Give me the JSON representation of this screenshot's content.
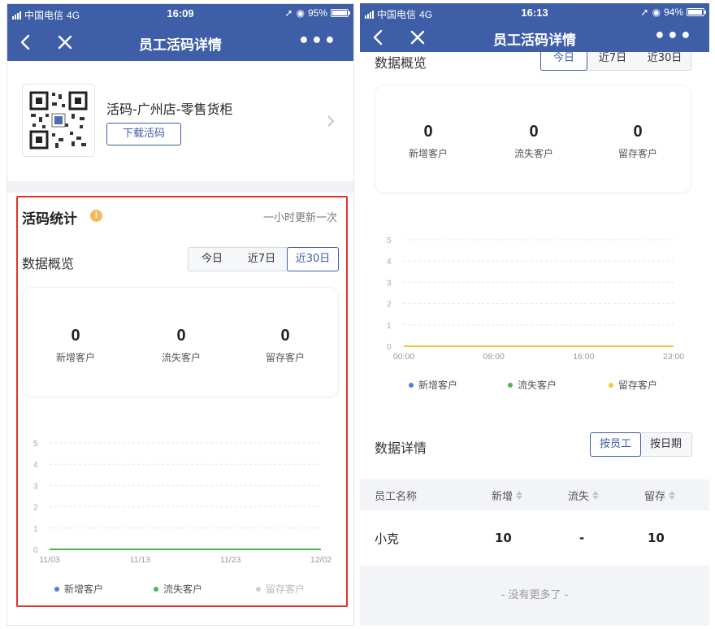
{
  "colors": {
    "nav": "#3e5ea8",
    "accent": "#3e5ea8",
    "highlight": "#e0342b",
    "series_new": "#4a7fe0",
    "series_lost": "#4fb35b",
    "series_keep": "#f0c945"
  },
  "left": {
    "status": {
      "carrier": "中国电信",
      "network": "4G",
      "time": "16:09",
      "battery": "95%"
    },
    "nav": {
      "title": "员工活码详情",
      "more": "•••"
    },
    "qr": {
      "name": "活码-广州店-零售货柜",
      "download_label": "下载活码"
    },
    "stats": {
      "title": "活码统计",
      "info_icon": "i",
      "update_note": "一小时更新一次",
      "overview_title": "数据概览",
      "ranges": [
        "今日",
        "近7日",
        "近30日"
      ],
      "active_range": "近30日",
      "items": [
        {
          "value": "0",
          "label": "新增客户"
        },
        {
          "value": "0",
          "label": "流失客户"
        },
        {
          "value": "0",
          "label": "留存客户"
        }
      ]
    },
    "legend": [
      "新增客户",
      "流失客户",
      "留存客户"
    ]
  },
  "right": {
    "status": {
      "carrier": "中国电信",
      "network": "4G",
      "time": "16:13",
      "battery": "94%"
    },
    "nav": {
      "title": "员工活码详情",
      "more": "•••"
    },
    "stats": {
      "overview_title": "数据概览",
      "ranges": [
        "今日",
        "近7日",
        "近30日"
      ],
      "items": [
        {
          "value": "0",
          "label": "新增客户"
        },
        {
          "value": "0",
          "label": "流失客户"
        },
        {
          "value": "0",
          "label": "留存客户"
        }
      ]
    },
    "legend": [
      "新增客户",
      "流失客户",
      "留存客户"
    ],
    "detail": {
      "title": "数据详情",
      "tabs": [
        "按员工",
        "按日期"
      ],
      "active_tab": "按员工",
      "columns": [
        "员工名称",
        "新增",
        "流失",
        "留存"
      ],
      "rows": [
        {
          "name": "小克",
          "new": "10",
          "lost": "-",
          "keep": "10"
        }
      ],
      "footer": "- 没有更多了 -"
    }
  },
  "chart_data": [
    {
      "type": "line",
      "x": [
        "11/03",
        "11/13",
        "11/23",
        "12/02"
      ],
      "ylim": [
        0,
        5
      ],
      "yticks": [
        0,
        1,
        2,
        3,
        4,
        5
      ],
      "grid": true,
      "legend_position": "bottom",
      "series": [
        {
          "name": "新增客户",
          "values": [
            0,
            0,
            0,
            0
          ]
        },
        {
          "name": "流失客户",
          "values": [
            0,
            0,
            0,
            0
          ]
        },
        {
          "name": "留存客户",
          "values": [
            0,
            0,
            0,
            0
          ]
        }
      ]
    },
    {
      "type": "line",
      "x": [
        "00:00",
        "08:00",
        "16:00",
        "23:00"
      ],
      "ylim": [
        0,
        5
      ],
      "yticks": [
        0,
        1,
        2,
        3,
        4,
        5
      ],
      "grid": true,
      "legend_position": "bottom",
      "series": [
        {
          "name": "新增客户",
          "values": [
            0,
            0,
            0,
            0
          ]
        },
        {
          "name": "流失客户",
          "values": [
            0,
            0,
            0,
            0
          ]
        },
        {
          "name": "留存客户",
          "values": [
            0,
            0,
            0,
            0
          ]
        }
      ]
    }
  ]
}
